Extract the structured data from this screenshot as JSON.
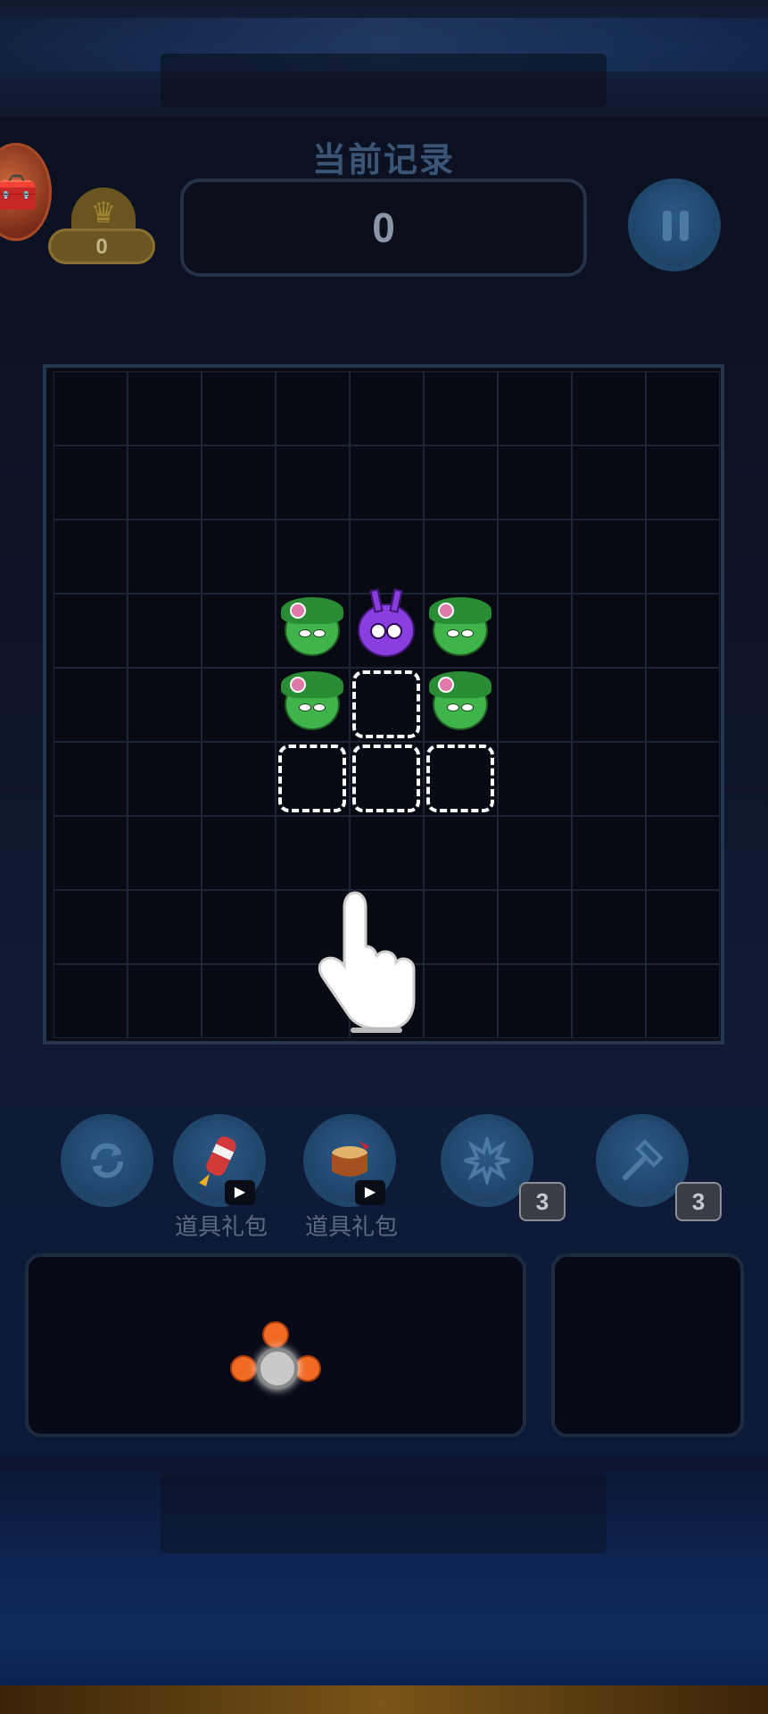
{
  "hud": {
    "record_title": "当前记录",
    "score": "0",
    "crown_count": "0"
  },
  "board": {
    "rows": 9,
    "cols": 9,
    "pieces": [
      {
        "row": 3,
        "col": 3,
        "kind": "green-character"
      },
      {
        "row": 3,
        "col": 4,
        "kind": "purple-character"
      },
      {
        "row": 3,
        "col": 5,
        "kind": "green-character"
      },
      {
        "row": 4,
        "col": 3,
        "kind": "green-character"
      },
      {
        "row": 4,
        "col": 5,
        "kind": "green-character"
      }
    ],
    "placement_hints": [
      {
        "row": 4,
        "col": 4
      },
      {
        "row": 5,
        "col": 3
      },
      {
        "row": 5,
        "col": 4
      },
      {
        "row": 5,
        "col": 5
      }
    ]
  },
  "tools": [
    {
      "name": "refresh",
      "icon": "refresh-icon"
    },
    {
      "name": "firework",
      "icon": "firework-icon",
      "label": "道具礼包"
    },
    {
      "name": "drum",
      "icon": "drum-icon",
      "label": "道具礼包"
    },
    {
      "name": "burst",
      "icon": "burst-icon",
      "count": "3"
    },
    {
      "name": "hammer",
      "icon": "hammer-icon",
      "count": "3"
    }
  ]
}
